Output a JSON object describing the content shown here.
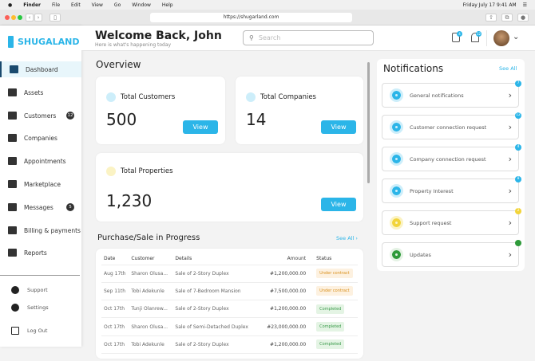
{
  "menubar": {
    "app": "Finder",
    "items": [
      "File",
      "Edit",
      "View",
      "Go",
      "Window",
      "Help"
    ],
    "clock": "Friday July 17  9:41 AM"
  },
  "browser": {
    "url": "https://shugarland.com"
  },
  "brand": "SHUGALAND",
  "sidebar": {
    "items": [
      {
        "label": "Dashboard",
        "active": true
      },
      {
        "label": "Assets"
      },
      {
        "label": "Customers",
        "badge": "12"
      },
      {
        "label": "Companies"
      },
      {
        "label": "Appointments"
      },
      {
        "label": "Marketplace"
      },
      {
        "label": "Messages",
        "badge": "5"
      },
      {
        "label": "Billing & payments"
      },
      {
        "label": "Reports"
      }
    ],
    "footer": [
      "Support",
      "Settings",
      "Log Out"
    ]
  },
  "header": {
    "title": "Welcome Back, John",
    "subtitle": "Here is what's happening today",
    "search_placeholder": "Search",
    "bookmark_badge": "4",
    "bell_badge": "12"
  },
  "overview": {
    "title": "Overview",
    "cards": [
      {
        "label": "Total Customers",
        "value": "500",
        "button": "View"
      },
      {
        "label": "Total Companies",
        "value": "14",
        "button": "View"
      },
      {
        "label": "Total Properties",
        "value": "1,230",
        "button": "View"
      }
    ]
  },
  "purchases": {
    "title": "Purchase/Sale in Progress",
    "see_all": "See All",
    "columns": [
      "Date",
      "Customer",
      "Details",
      "Amount",
      "Status"
    ],
    "rows": [
      [
        "Aug 17th",
        "Sharon Olusa...",
        "Sale of 2-Story Duplex",
        "#1,200,000.00",
        "Under contract"
      ],
      [
        "Sep 11th",
        "Tobi Adekunle",
        "Sale of 7-Bedroom Mansion",
        "#7,500,000.00",
        "Under contract"
      ],
      [
        "Oct 17th",
        "Tunji Olanrew...",
        "Sale of 2-Story Duplex",
        "#1,200,000.00",
        "Completed"
      ],
      [
        "Oct 17th",
        "Sharon Olusa...",
        "Sale of Semi-Detached Duplex",
        "#23,000,000.00",
        "Completed"
      ],
      [
        "Oct 17th",
        "Tobi Adekunle",
        "Sale of 2-Story Duplex",
        "#1,200,000.00",
        "Completed"
      ]
    ]
  },
  "notifications": {
    "title": "Notifications",
    "see_all": "See All",
    "items": [
      {
        "label": "General notifications",
        "badge": "7",
        "icon": "bell-icon",
        "color": "#2bb5e8",
        "bg": "#cdeefa"
      },
      {
        "label": "Customer connection request",
        "badge": "12",
        "icon": "users-icon",
        "color": "#2bb5e8",
        "bg": "#cdeefa"
      },
      {
        "label": "Company connection request",
        "badge": "4",
        "icon": "building-icon",
        "color": "#2bb5e8",
        "bg": "#cdeefa"
      },
      {
        "label": "Property Interest",
        "badge": "8",
        "icon": "property-icon",
        "color": "#2bb5e8",
        "bg": "#cdeefa"
      },
      {
        "label": "Support request",
        "badge": "2",
        "icon": "support-icon",
        "color": "#f2d43a",
        "bg": "#fbf3c4"
      },
      {
        "label": "Updates",
        "badge": "",
        "icon": "refresh-icon",
        "color": "#2e9a3a",
        "bg": "#e4f2e4"
      }
    ]
  }
}
